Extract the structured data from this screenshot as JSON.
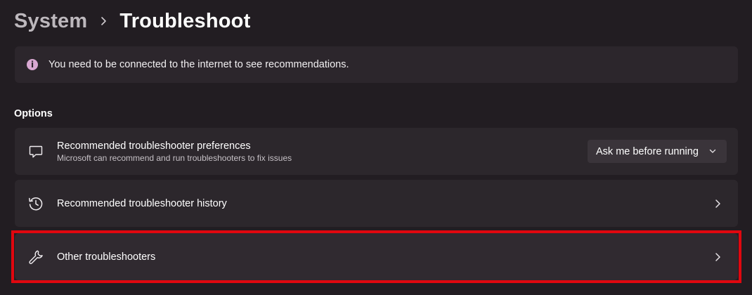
{
  "breadcrumb": {
    "parent": "System",
    "current": "Troubleshoot"
  },
  "info_bar": {
    "icon": "info-icon",
    "icon_glyph": "i",
    "text": "You need to be connected to the internet to see recommendations."
  },
  "options": {
    "section_title": "Options",
    "items": [
      {
        "icon": "feedback-bubble-icon",
        "title": "Recommended troubleshooter preferences",
        "subtitle": "Microsoft can recommend and run troubleshooters to fix issues",
        "control": {
          "type": "dropdown",
          "selected": "Ask me before running"
        }
      },
      {
        "icon": "history-icon",
        "title": "Recommended troubleshooter history",
        "control": {
          "type": "chevron"
        }
      },
      {
        "icon": "wrench-icon",
        "title": "Other troubleshooters",
        "control": {
          "type": "chevron"
        },
        "highlighted": true
      }
    ]
  },
  "colors": {
    "background": "#221d22",
    "card": "#2c272c",
    "highlight_border": "#e0070f",
    "info_accent": "#d9a8d2"
  }
}
